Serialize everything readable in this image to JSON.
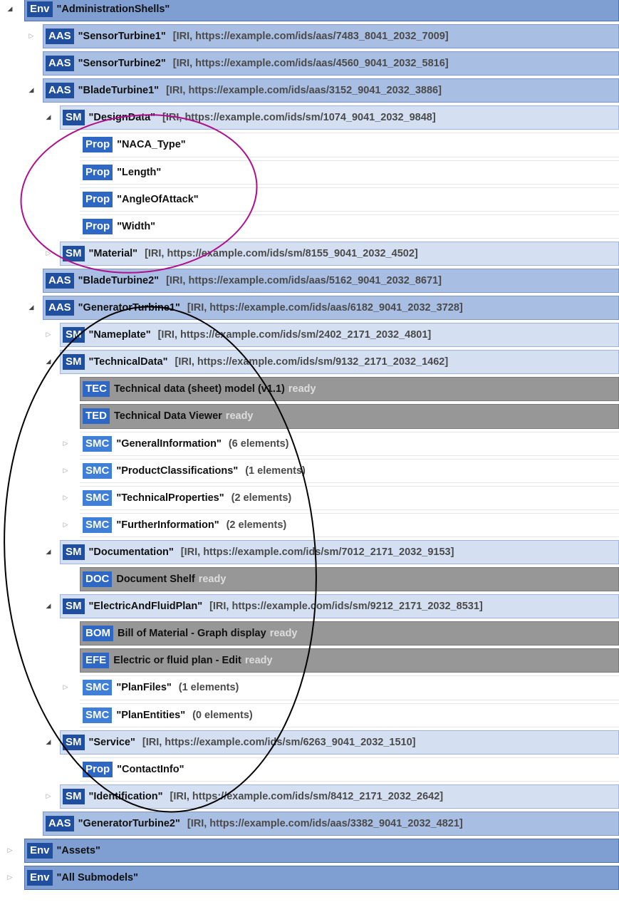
{
  "tree": {
    "rows": [
      {
        "kind": "env",
        "toggle": "◢",
        "tag": "Env",
        "name": "\"AdministrationShells\""
      },
      {
        "kind": "aas",
        "toggle": "▷",
        "tag": "AAS",
        "name": "\"SensorTurbine1\"",
        "info": "[IRI, https://example.com/ids/aas/7483_8041_2032_7009]"
      },
      {
        "kind": "aas",
        "toggle": "",
        "tag": "AAS",
        "name": "\"SensorTurbine2\"",
        "info": "[IRI, https://example.com/ids/aas/4560_9041_2032_5816]"
      },
      {
        "kind": "aas",
        "toggle": "◢",
        "tag": "AAS",
        "name": "\"BladeTurbine1\"",
        "info": "[IRI, https://example.com/ids/aas/3152_9041_2032_3886]"
      },
      {
        "kind": "sm",
        "toggle": "◢",
        "tag": "SM",
        "name": "\"DesignData\"",
        "info": "[IRI, https://example.com/ids/sm/1074_9041_2032_9848]"
      },
      {
        "kind": "prop",
        "toggle": "",
        "tag": "Prop",
        "name": "\"NACA_Type\""
      },
      {
        "kind": "prop",
        "toggle": "",
        "tag": "Prop",
        "name": "\"Length\""
      },
      {
        "kind": "prop",
        "toggle": "",
        "tag": "Prop",
        "name": "\"AngleOfAttack\""
      },
      {
        "kind": "prop",
        "toggle": "",
        "tag": "Prop",
        "name": "\"Width\""
      },
      {
        "kind": "sm",
        "toggle": "▷",
        "tag": "SM",
        "name": "\"Material\"",
        "info": "[IRI, https://example.com/ids/sm/8155_9041_2032_4502]"
      },
      {
        "kind": "aas",
        "toggle": "",
        "tag": "AAS",
        "name": "\"BladeTurbine2\"",
        "info": "[IRI, https://example.com/ids/aas/5162_9041_2032_8671]"
      },
      {
        "kind": "aas",
        "toggle": "◢",
        "tag": "AAS",
        "name": "\"GeneratorTurbine1\"",
        "info": "[IRI, https://example.com/ids/aas/6182_9041_2032_3728]"
      },
      {
        "kind": "sm",
        "toggle": "▷",
        "tag": "SM",
        "name": "\"Nameplate\"",
        "info": "[IRI, https://example.com/ids/sm/2402_2171_2032_4801]"
      },
      {
        "kind": "sm",
        "toggle": "◢",
        "tag": "SM",
        "name": "\"TechnicalData\"",
        "info": "[IRI, https://example.com/ids/sm/9132_2171_2032_1462]"
      },
      {
        "kind": "plug",
        "toggle": "",
        "tag": "TEC",
        "name": "Technical data (sheet) model (v1.1)",
        "status": "ready"
      },
      {
        "kind": "plug",
        "toggle": "",
        "tag": "TED",
        "name": "Technical Data Viewer",
        "status": "ready"
      },
      {
        "kind": "smc",
        "toggle": "▷",
        "tag": "SMC",
        "name": "\"GeneralInformation\"",
        "info": "(6 elements)"
      },
      {
        "kind": "smc",
        "toggle": "▷",
        "tag": "SMC",
        "name": "\"ProductClassifications\"",
        "info": "(1 elements)"
      },
      {
        "kind": "smc",
        "toggle": "▷",
        "tag": "SMC",
        "name": "\"TechnicalProperties\"",
        "info": "(2 elements)"
      },
      {
        "kind": "smc",
        "toggle": "▷",
        "tag": "SMC",
        "name": "\"FurtherInformation\"",
        "info": "(2 elements)"
      },
      {
        "kind": "sm",
        "toggle": "◢",
        "tag": "SM",
        "name": "\"Documentation\"",
        "info": "[IRI, https://example.com/ids/sm/7012_2171_2032_9153]"
      },
      {
        "kind": "plug",
        "toggle": "",
        "tag": "DOC",
        "name": "Document Shelf",
        "status": "ready"
      },
      {
        "kind": "sm",
        "toggle": "◢",
        "tag": "SM",
        "name": "\"ElectricAndFluidPlan\"",
        "info": "[IRI, https://example.com/ids/sm/9212_2171_2032_8531]"
      },
      {
        "kind": "plug",
        "toggle": "",
        "tag": "BOM",
        "name": "Bill of Material - Graph display",
        "status": "ready"
      },
      {
        "kind": "plug",
        "toggle": "",
        "tag": "EFE",
        "name": "Electric or fluid plan - Edit",
        "status": "ready"
      },
      {
        "kind": "smc",
        "toggle": "▷",
        "tag": "SMC",
        "name": "\"PlanFiles\"",
        "info": "(1 elements)"
      },
      {
        "kind": "smc",
        "toggle": "",
        "tag": "SMC",
        "name": "\"PlanEntities\"",
        "info": "(0 elements)"
      },
      {
        "kind": "sm",
        "toggle": "◢",
        "tag": "SM",
        "name": "\"Service\"",
        "info": "[IRI, https://example.com/ids/sm/6263_9041_2032_1510]"
      },
      {
        "kind": "prop",
        "toggle": "",
        "tag": "Prop",
        "name": "\"ContactInfo\""
      },
      {
        "kind": "sm",
        "toggle": "▷",
        "tag": "SM",
        "name": "\"Identification\"",
        "info": "[IRI, https://example.com/ids/sm/8412_2171_2032_2642]"
      },
      {
        "kind": "aas",
        "toggle": "",
        "tag": "AAS",
        "name": "\"GeneratorTurbine2\"",
        "info": "[IRI, https://example.com/ids/aas/3382_9041_2032_4821]"
      },
      {
        "kind": "env",
        "toggle": "▷",
        "tag": "Env",
        "name": "\"Assets\""
      },
      {
        "kind": "env",
        "toggle": "▷",
        "tag": "Env",
        "name": "\"All Submodels\""
      }
    ]
  },
  "colors": {
    "env_bar": "#7f9fd3",
    "aas_bar": "#a8bee3",
    "sm_bar": "#d4e0f2",
    "plugin_bar": "#979797",
    "tag_dark": "#1f4f9e",
    "tag_mid": "#2e67c4",
    "tag_light": "#3f7fd8",
    "annotation_magenta": "#b0108c",
    "annotation_black": "#000000"
  }
}
